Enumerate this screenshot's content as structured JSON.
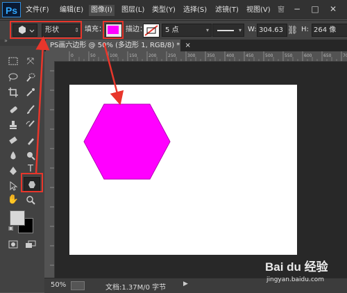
{
  "app": {
    "logo": "Ps"
  },
  "menubar": {
    "items": [
      "文件(F)",
      "编辑(E)",
      "图像(I)",
      "图层(L)",
      "类型(Y)",
      "选择(S)",
      "滤镜(T)",
      "视图(V)"
    ],
    "active_index": 2,
    "window_buttons": [
      "−",
      "□",
      "✕"
    ]
  },
  "options": {
    "mode": "形状",
    "fill_label": "填充：",
    "fill_color": "#ff00ff",
    "stroke_label": "描边：",
    "stroke_size": "5 点",
    "w_label": "W:",
    "w_value": "304.63",
    "h_label": "H:",
    "h_value": "264 像"
  },
  "document": {
    "tab_title": "PS画六边形 @ 50% (多边形 1, RGB/8) *",
    "tab_close": "×",
    "zoom": "50%",
    "status": "文档:1.37M/0 字节",
    "shape_color": "#ff00ff",
    "ruler_marks": [
      "0",
      "50",
      "100",
      "150",
      "200",
      "250",
      "300",
      "350",
      "400",
      "450",
      "500",
      "550",
      "600",
      "650",
      "700"
    ]
  },
  "watermark": {
    "brand": "Bai du 经验",
    "url": "jingyan.baidu.com"
  }
}
